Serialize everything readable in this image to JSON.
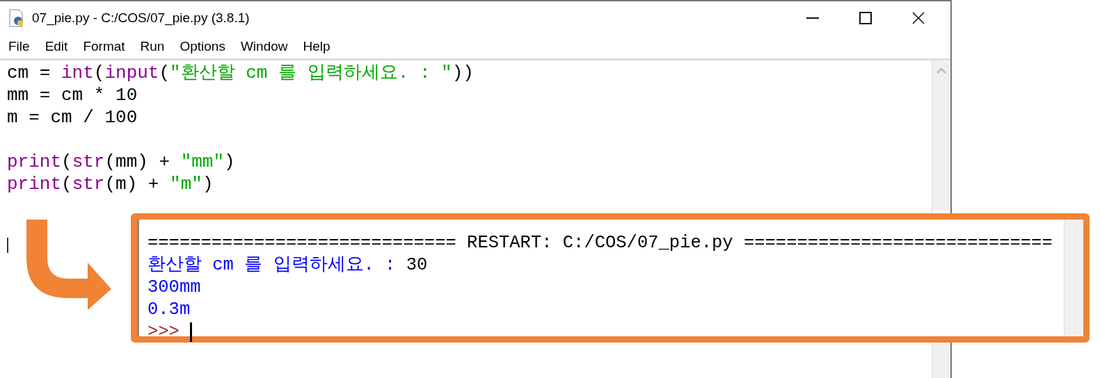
{
  "window": {
    "title": "07_pie.py - C:/COS/07_pie.py (3.8.1)"
  },
  "menu": [
    "File",
    "Edit",
    "Format",
    "Run",
    "Options",
    "Window",
    "Help"
  ],
  "editor": {
    "lines": [
      {
        "kind": "code",
        "segments": [
          {
            "kind": "plain",
            "text": "cm = "
          },
          {
            "kind": "builtin",
            "text": "int"
          },
          {
            "kind": "plain",
            "text": "("
          },
          {
            "kind": "builtin",
            "text": "input"
          },
          {
            "kind": "plain",
            "text": "("
          },
          {
            "kind": "string",
            "text": "\"환산할 cm 를 입력하세요. : \""
          },
          {
            "kind": "plain",
            "text": "))"
          }
        ]
      },
      {
        "kind": "code",
        "segments": [
          {
            "kind": "plain",
            "text": "mm = cm * 10"
          }
        ]
      },
      {
        "kind": "code",
        "segments": [
          {
            "kind": "plain",
            "text": "m = cm / 100"
          }
        ]
      },
      {
        "kind": "blank"
      },
      {
        "kind": "code",
        "segments": [
          {
            "kind": "builtin",
            "text": "print"
          },
          {
            "kind": "plain",
            "text": "("
          },
          {
            "kind": "builtin",
            "text": "str"
          },
          {
            "kind": "plain",
            "text": "(mm) + "
          },
          {
            "kind": "string",
            "text": "\"mm\""
          },
          {
            "kind": "plain",
            "text": ")"
          }
        ]
      },
      {
        "kind": "code",
        "segments": [
          {
            "kind": "builtin",
            "text": "print"
          },
          {
            "kind": "plain",
            "text": "("
          },
          {
            "kind": "builtin",
            "text": "str"
          },
          {
            "kind": "plain",
            "text": "(m) + "
          },
          {
            "kind": "string",
            "text": "\"m\""
          },
          {
            "kind": "plain",
            "text": ")"
          }
        ]
      }
    ]
  },
  "shell": {
    "lines": [
      [
        {
          "kind": "plain",
          "text": "============================= RESTART: C:/COS/07_pie.py ============================="
        }
      ],
      [
        {
          "kind": "output",
          "text": "환산할 cm 를 입력하세요. : "
        },
        {
          "kind": "plain",
          "text": "30"
        }
      ],
      [
        {
          "kind": "output",
          "text": "300mm"
        }
      ],
      [
        {
          "kind": "output",
          "text": "0.3m"
        }
      ],
      [
        {
          "kind": "prompt",
          "text": ">>> "
        }
      ]
    ]
  }
}
